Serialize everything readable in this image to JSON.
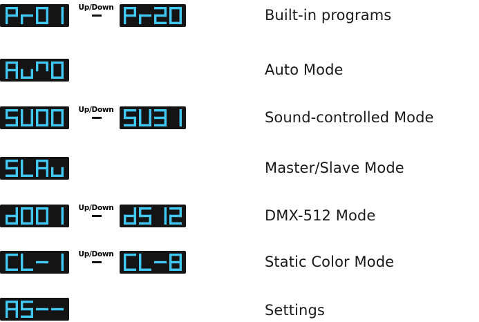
{
  "accent_color": "#41c8f3",
  "display_background": "#141414",
  "arrow_label": "Up/Down",
  "rows": [
    {
      "from": "Pr01",
      "to": "Pr20",
      "description": "Built-in programs"
    },
    {
      "from": "AuTO",
      "description": "Auto Mode"
    },
    {
      "from": "SU00",
      "to": "SU31",
      "description": "Sound-controlled Mode"
    },
    {
      "from": "SLAu",
      "description": "Master/Slave Mode"
    },
    {
      "from": "d001",
      "to": "dS12",
      "description": "DMX-512 Mode"
    },
    {
      "from": "CL-1",
      "to": "CL-8",
      "description": "Static Color Mode"
    },
    {
      "from": "AS--",
      "description": "Settings"
    }
  ]
}
